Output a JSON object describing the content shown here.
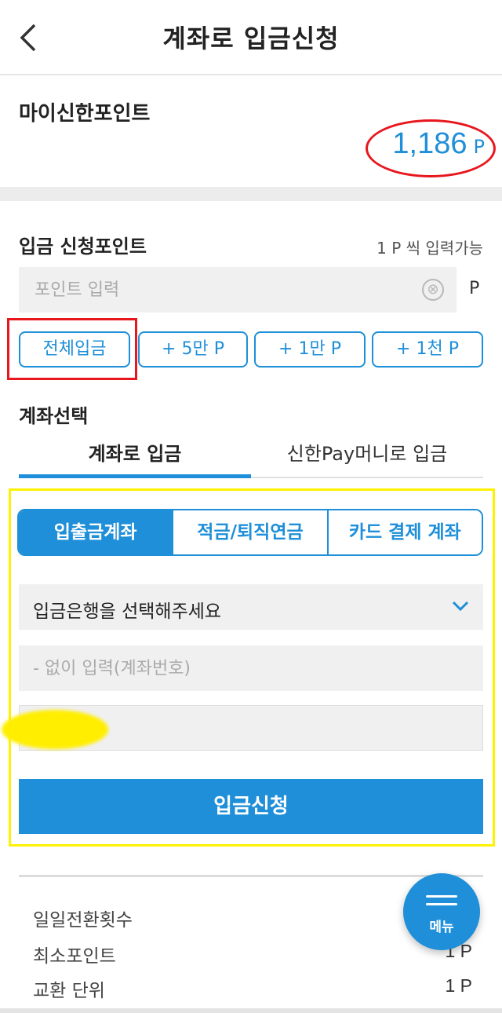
{
  "header": {
    "title": "계좌로 입금신청"
  },
  "my_point": {
    "label": "마이신한포인트",
    "value": "1,186",
    "unit": "P"
  },
  "apply": {
    "label": "입금 신청포인트",
    "hint": "1 P 씩 입력가능",
    "input_placeholder": "포인트 입력",
    "clear_icon": "⊗",
    "unit": "P",
    "quick_buttons": [
      "전체입금",
      "+ 5만 P",
      "+ 1만 P",
      "+ 1천 P"
    ]
  },
  "account": {
    "label": "계좌선택",
    "tabs": [
      "계좌로 입금",
      "신한Pay머니로 입금"
    ],
    "active_tab": 0,
    "segments": [
      "입출금계좌",
      "적금/퇴직연금",
      "카드 결제 계좌"
    ],
    "active_segment": 0,
    "bank_select_placeholder": "입금은행을 선택해주세요",
    "account_placeholder": "- 없이 입력(계좌번호)",
    "submit_label": "입금신청"
  },
  "info": [
    {
      "label": "일일전환횟수",
      "value": ""
    },
    {
      "label": "최소포인트",
      "value": "1 P"
    },
    {
      "label": "교환 단위",
      "value": "1 P"
    }
  ],
  "menu_fab": {
    "label": "메뉴",
    "icon": "hamburger-icon"
  },
  "colors": {
    "accent": "#1e8fd8",
    "annotation_red": "#e8161d",
    "annotation_yellow": "#fff200"
  }
}
